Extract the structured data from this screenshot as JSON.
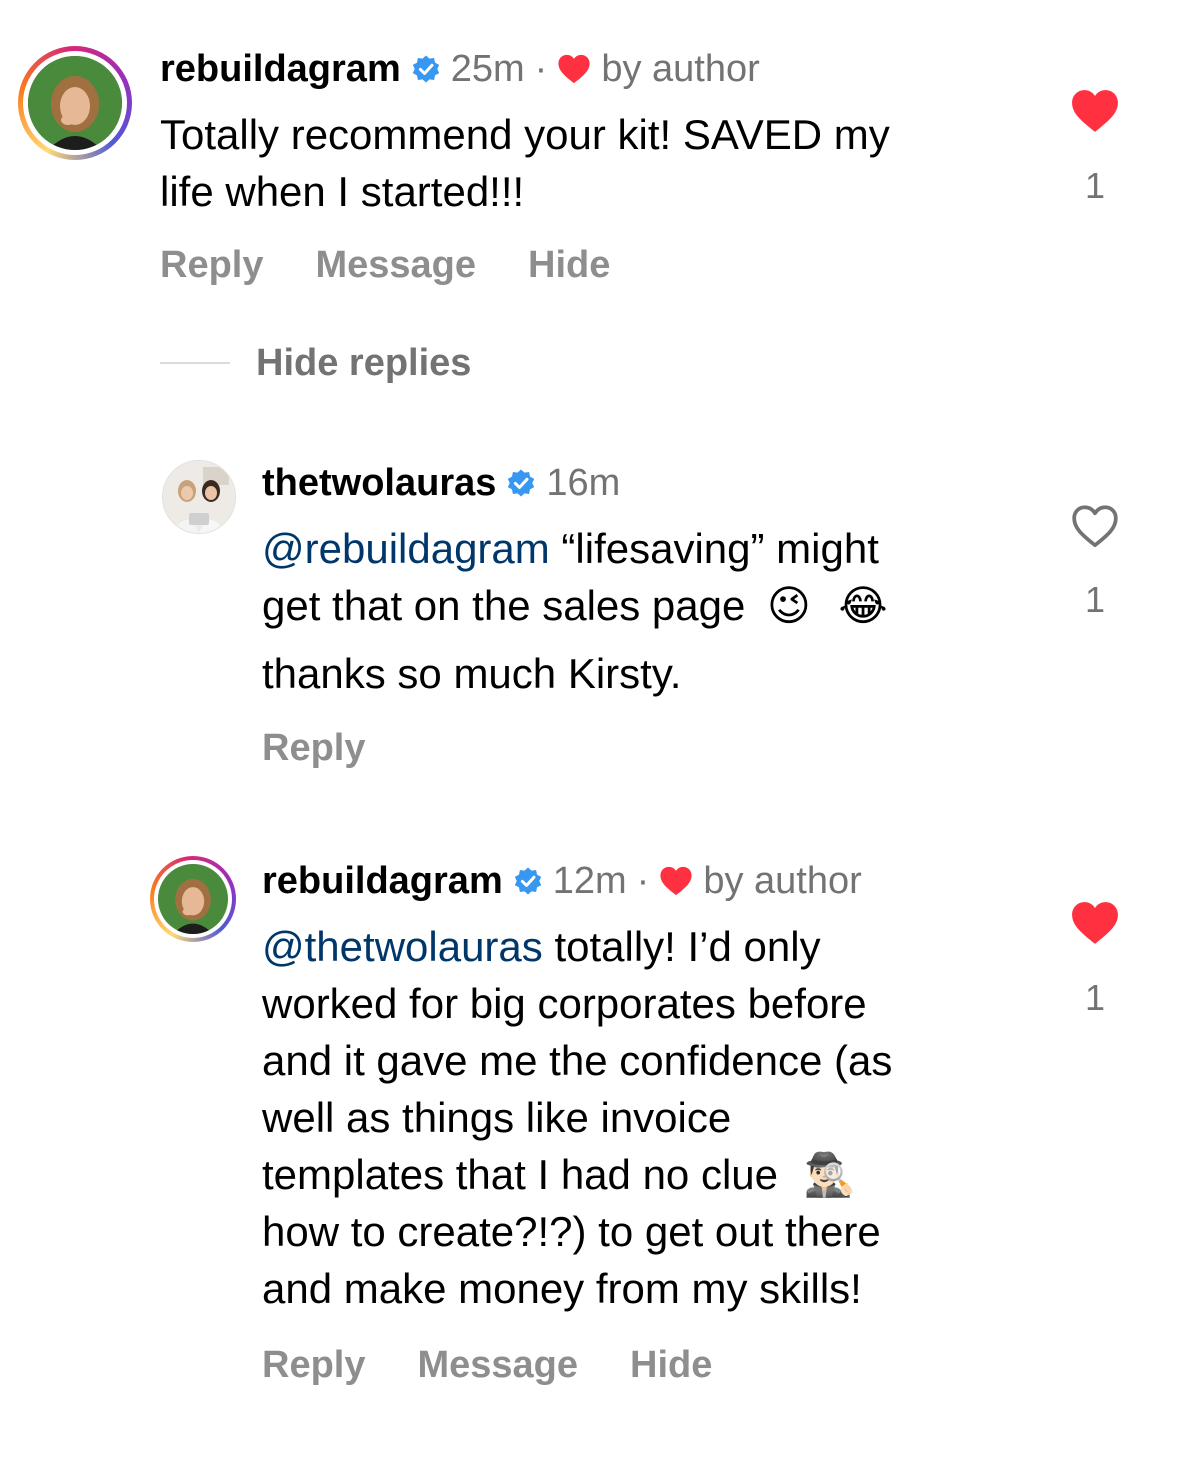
{
  "colors": {
    "heart_red": "#ff3040",
    "verified_blue": "#3897f0",
    "mention": "#00376b",
    "muted": "#737373",
    "action": "#8e8e8e"
  },
  "comments": [
    {
      "username": "rebuildagram",
      "time": "25m",
      "dot": "·",
      "liked_by_author": "by author",
      "text_lines": [
        "Totally recommend your kit! SAVED my",
        "life when I started!!!"
      ],
      "like_count": "1",
      "liked": true,
      "actions": {
        "reply": "Reply",
        "message": "Message",
        "hide": "Hide"
      }
    }
  ],
  "hide_replies_label": "Hide replies",
  "replies": [
    {
      "username": "thetwolauras",
      "time": "16m",
      "mention": "@rebuildagram",
      "line1_rest": " “lifesaving” might",
      "line2": "get that on the sales page",
      "emoji1": "😉",
      "emoji2": "😂",
      "line3": "thanks so much Kirsty.",
      "like_count": "1",
      "liked": false,
      "actions": {
        "reply": "Reply"
      }
    },
    {
      "username": "rebuildagram",
      "time": "12m",
      "dot": "·",
      "liked_by_author": "by author",
      "mention": "@thetwolauras",
      "line1_rest": " totally! I’d only",
      "lines": [
        "worked for big corporates before",
        "and it gave me the confidence (as",
        "well as things like invoice"
      ],
      "line5": "templates that I had no clue",
      "emoji": "🕵🏻‍♂️",
      "lines_after": [
        "how to create?!?) to get out there",
        "and make money from my skills!"
      ],
      "like_count": "1",
      "liked": true,
      "actions": {
        "reply": "Reply",
        "message": "Message",
        "hide": "Hide"
      }
    }
  ]
}
